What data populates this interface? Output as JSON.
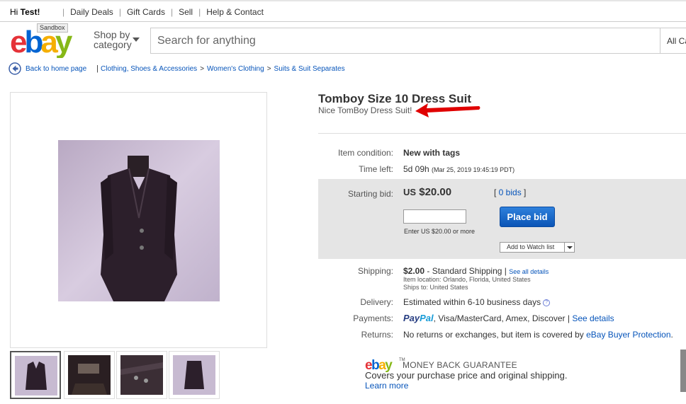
{
  "topbar": {
    "greeting_prefix": "Hi ",
    "greeting_name": "Test!",
    "links": [
      "Daily Deals",
      "Gift Cards",
      "Sell",
      "Help & Contact"
    ]
  },
  "header": {
    "logo_text": "ebay",
    "sandbox_label": "Sandbox",
    "shop_by_line1": "Shop by",
    "shop_by_line2": "category",
    "search_placeholder": "Search for anything",
    "category_select": "All Ca"
  },
  "breadcrumb": {
    "back_label": "Back to home page",
    "separator": "|",
    "path": [
      "Clothing, Shoes & Accessories",
      "Women's Clothing",
      "Suits & Suit Separates"
    ],
    "path_sep": ">"
  },
  "listing": {
    "title": "Tomboy Size 10 Dress Suit",
    "subtitle": "Nice TomBoy Dress Suit!",
    "condition_label": "Item condition:",
    "condition_value": "New with tags",
    "time_left_label": "Time left:",
    "time_left_value": "5d 09h",
    "time_left_date": "(Mar 25, 2019  19:45:19 PDT)",
    "starting_bid_label": "Starting bid:",
    "currency": "US",
    "price": "$20.00",
    "bids_open": "[ ",
    "bids_link": "0 bids",
    "bids_close": " ]",
    "bid_input_value": "",
    "enter_hint": "Enter US $20.00 or more",
    "place_bid_label": "Place bid",
    "watch_label": "Add to Watch list",
    "shipping_label": "Shipping:",
    "shipping_cost": "$2.00",
    "shipping_method": " - Standard Shipping  |",
    "shipping_details_link": "See all details",
    "item_location": "Item location: Orlando, Florida, United States",
    "ships_to": "Ships to: United States",
    "delivery_label": "Delivery:",
    "delivery_value": "Estimated within 6-10 business days",
    "payments_label": "Payments:",
    "paypal_part1": "Pay",
    "paypal_part2": "Pal",
    "payments_value": ", Visa/MasterCard, Amex, Discover",
    "payments_sep": "|",
    "payments_link": "See details",
    "returns_label": "Returns:",
    "returns_value": "No returns or exchanges, but item is covered by ",
    "returns_link": "eBay Buyer Protection",
    "returns_end": "."
  },
  "guarantee": {
    "logo_text": "ebay",
    "tm": "TM",
    "title": "MONEY BACK GUARANTEE",
    "coverage": "Covers your purchase price and original shipping.",
    "learn_more": "Learn more"
  },
  "icons": {
    "back": "back-arrow-circle-icon",
    "help": "question-circle-icon",
    "annotation": "red-arrow-annotation"
  },
  "colors": {
    "link": "#0654ba",
    "button": "#0b55b6",
    "ebay_red": "#e53238",
    "ebay_blue": "#0064d2",
    "ebay_yellow": "#f5af02",
    "ebay_green": "#86b817",
    "bid_panel": "#e5e5e5",
    "annotation_red": "#e00000"
  }
}
